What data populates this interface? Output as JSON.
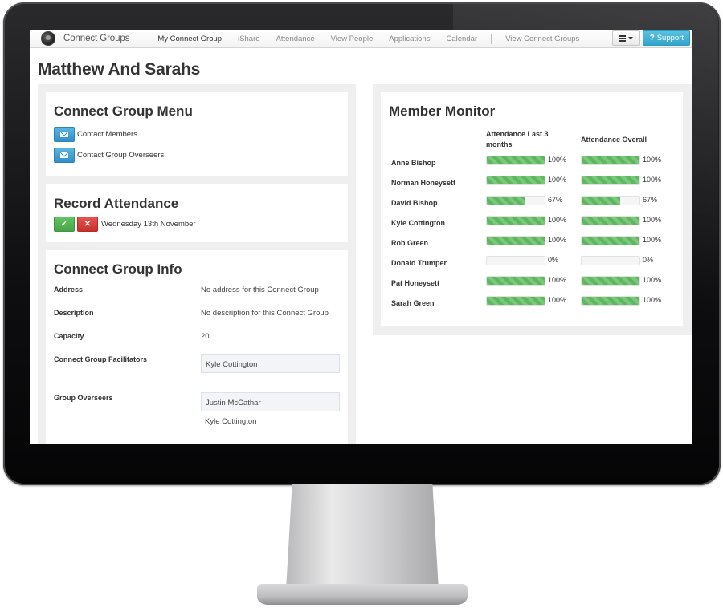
{
  "navbar": {
    "brand": "Connect Groups",
    "links": [
      {
        "label": "My Connect Group",
        "active": true
      },
      {
        "label": "iShare",
        "active": false
      },
      {
        "label": "Attendance",
        "active": false
      },
      {
        "label": "View People",
        "active": false
      },
      {
        "label": "Applications",
        "active": false
      },
      {
        "label": "Calendar",
        "active": false
      }
    ],
    "secondary_link": "View Connect Groups",
    "menu_icon": "list-icon",
    "support_label": "Support",
    "support_icon": "question-icon"
  },
  "page": {
    "title": "Matthew And Sarahs"
  },
  "menu": {
    "title": "Connect Group Menu",
    "items": [
      {
        "label": "Contact Members",
        "icon": "envelope-icon"
      },
      {
        "label": "Contact Group Overseers",
        "icon": "envelope-icon"
      }
    ]
  },
  "attendance": {
    "title": "Record Attendance",
    "ok_icon": "✓",
    "no_icon": "✕",
    "date": "Wednesday 13th November"
  },
  "info": {
    "title": "Connect Group Info",
    "address_label": "Address",
    "address_value": "No address for this Connect Group",
    "description_label": "Description",
    "description_value": "No description for this Connect Group",
    "capacity_label": "Capacity",
    "capacity_value": "20",
    "facilitators_label": "Connect Group Facilitators",
    "facilitators": [
      "Kyle Cottington"
    ],
    "overseers_label": "Group Overseers",
    "overseers": [
      "Justin McCathar",
      "Kyle Cottington"
    ]
  },
  "monitor": {
    "title": "Member Monitor",
    "col_recent": "Attendance Last 3 months",
    "col_overall": "Attendance Overall",
    "bar_color": "#5cb85c",
    "members": [
      {
        "name": "Anne Bishop",
        "recent": 100,
        "recent_label": "100%",
        "overall": 100,
        "overall_label": "100%"
      },
      {
        "name": "Norman Honeysett",
        "recent": 100,
        "recent_label": "100%",
        "overall": 100,
        "overall_label": "100%"
      },
      {
        "name": "David Bishop",
        "recent": 67,
        "recent_label": "67%",
        "overall": 67,
        "overall_label": "67%"
      },
      {
        "name": "Kyle Cottington",
        "recent": 100,
        "recent_label": "100%",
        "overall": 100,
        "overall_label": "100%"
      },
      {
        "name": "Rob Green",
        "recent": 100,
        "recent_label": "100%",
        "overall": 100,
        "overall_label": "100%"
      },
      {
        "name": "Donald Trumper",
        "recent": 0,
        "recent_label": "0%",
        "overall": 0,
        "overall_label": "0%"
      },
      {
        "name": "Pat Honeysett",
        "recent": 100,
        "recent_label": "100%",
        "overall": 100,
        "overall_label": "100%"
      },
      {
        "name": "Sarah Green",
        "recent": 100,
        "recent_label": "100%",
        "overall": 100,
        "overall_label": "100%"
      }
    ]
  }
}
